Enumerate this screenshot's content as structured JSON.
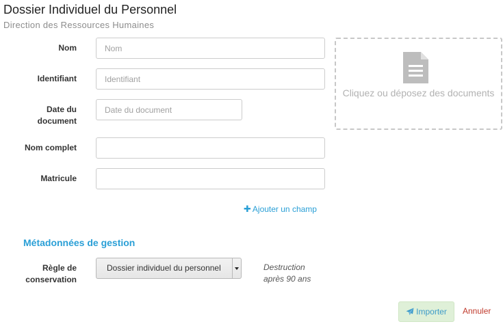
{
  "header": {
    "title": "Dossier Individuel du Personnel",
    "subtitle": "Direction des Ressources Humaines"
  },
  "fields": [
    {
      "label": "Nom",
      "placeholder": "Nom",
      "value": ""
    },
    {
      "label": "Identifiant",
      "placeholder": "Identifiant",
      "value": ""
    },
    {
      "label": "Date du document",
      "placeholder": "Date du document",
      "value": ""
    },
    {
      "label": "Nom complet",
      "placeholder": "",
      "value": ""
    },
    {
      "label": "Matricule",
      "placeholder": "",
      "value": ""
    }
  ],
  "dropzone": {
    "text": "Cliquez ou déposez des documents",
    "icon": "document-icon"
  },
  "add_field": {
    "icon": "plus-icon",
    "label": "Ajouter un champ"
  },
  "management": {
    "section_title": "Métadonnées de gestion",
    "retention_label": "Règle de conservation",
    "retention_selected": "Dossier individuel du personnel",
    "retention_note": "Destruction après 90 ans"
  },
  "actions": {
    "import_label": "Importer",
    "import_icon": "paper-plane-icon",
    "cancel_label": "Annuler"
  },
  "colors": {
    "accent": "#2a9fd6",
    "import_bg": "#dff0d8",
    "cancel": "#c0392b",
    "dropzone_border": "#c7c7c7"
  }
}
